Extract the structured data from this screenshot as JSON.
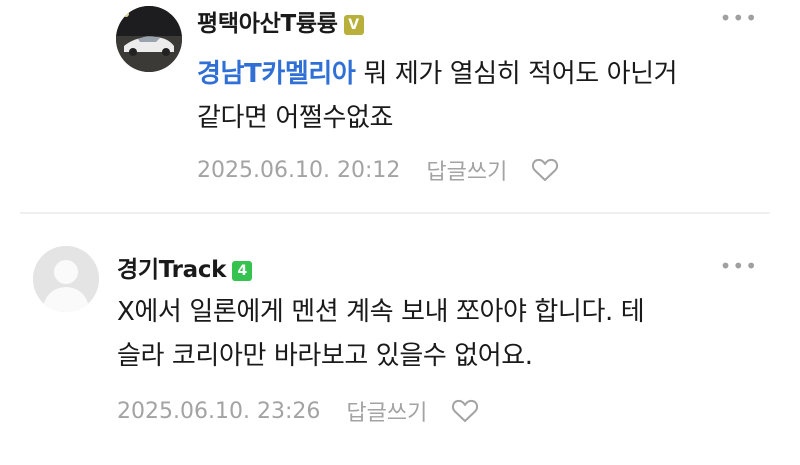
{
  "comments": [
    {
      "author": "평택아산T륭륭",
      "badge": "V",
      "mention": "경남T카멜리아",
      "line1": "뭐 제가 열심히 적어도 아닌거",
      "line2": "같다면 어쩔수없죠",
      "date": "2025.06.10. 20:12",
      "reply_label": "답글쓰기",
      "more_label": "•••"
    },
    {
      "author": "경기Track",
      "badge": "4",
      "line1": "X에서 일론에게 멘션 계속 보내 쪼아야 합니다. 테",
      "line2": "슬라 코리아만 바라보고 있을수 없어요.",
      "date": "2025.06.10. 23:26",
      "reply_label": "답글쓰기",
      "more_label": "•••"
    }
  ],
  "colors": {
    "mention": "#2f6fd6",
    "badge_v": "#b8b03a",
    "badge_level": "#35c24f",
    "meta_text": "#a3a3a3"
  },
  "icons": [
    "profile-photo",
    "default-avatar-icon",
    "more-options-icon",
    "heart-icon"
  ]
}
